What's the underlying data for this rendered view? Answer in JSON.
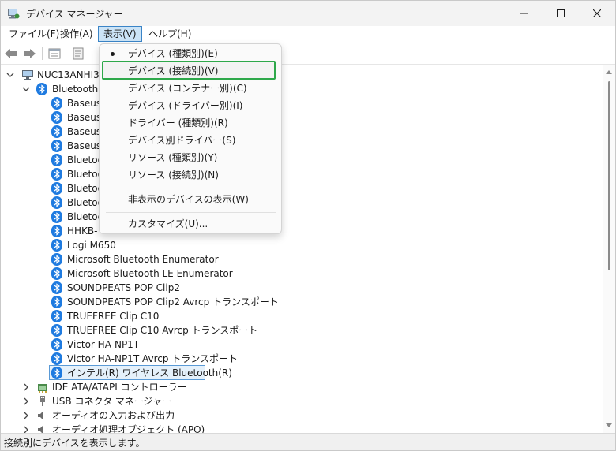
{
  "window": {
    "title": "デバイス マネージャー"
  },
  "menubar": {
    "items": [
      "ファイル(F)",
      "操作(A)",
      "表示(V)",
      "ヘルプ(H)"
    ],
    "active_index": 2
  },
  "toolbar": {
    "icons": [
      "back-arrow-icon",
      "forward-arrow-icon",
      "properties-icon",
      "help-icon"
    ]
  },
  "tree": {
    "root": "NUC13ANHI3",
    "category_open": "Bluetooth",
    "bluetooth_devices": [
      "Baseus",
      "Baseus",
      "Baseus",
      "Baseus",
      "Bluetoo",
      "Bluetoo",
      "Bluetoo",
      "Bluetoo",
      "Bluetoo",
      "HHKB-",
      "Logi M650",
      "Microsoft Bluetooth Enumerator",
      "Microsoft Bluetooth LE Enumerator",
      "SOUNDPEATS POP Clip2",
      "SOUNDPEATS POP Clip2 Avrcp トランスポート",
      "TRUEFREE Clip C10",
      "TRUEFREE Clip C10 Avrcp トランスポート",
      "Victor HA-NP1T",
      "Victor HA-NP1T Avrcp トランスポート",
      "インテル(R) ワイヤレス Bluetooth(R)"
    ],
    "selected_index": 19,
    "other_categories": [
      "IDE ATA/ATAPI コントローラー",
      "USB コネクタ マネージャー",
      "オーディオの入力および出力",
      "オーディオ処理オブジェクト (APO)"
    ]
  },
  "dropdown": {
    "items": [
      {
        "label": "デバイス (種類別)(E)",
        "checked": true
      },
      {
        "label": "デバイス (接続別)(V)",
        "checked": false,
        "highlighted": true
      },
      {
        "label": "デバイス (コンテナー別)(C)",
        "checked": false
      },
      {
        "label": "デバイス (ドライバー別)(I)",
        "checked": false
      },
      {
        "label": "ドライバー (種類別)(R)",
        "checked": false
      },
      {
        "label": "デバイス別ドライバー(S)",
        "checked": false
      },
      {
        "label": "リソース (種類別)(Y)",
        "checked": false
      },
      {
        "label": "リソース (接続別)(N)",
        "checked": false
      }
    ],
    "hidden_devices_label": "非表示のデバイスの表示(W)",
    "customize_label": "カスタマイズ(U)..."
  },
  "status": {
    "text": "接続別にデバイスを表示します。"
  },
  "colors": {
    "bluetooth_blue": "#1f7be0",
    "highlight_green": "#2ea84a",
    "menu_active_bg": "#cce4f7",
    "selection_border": "#5a9ad6"
  }
}
